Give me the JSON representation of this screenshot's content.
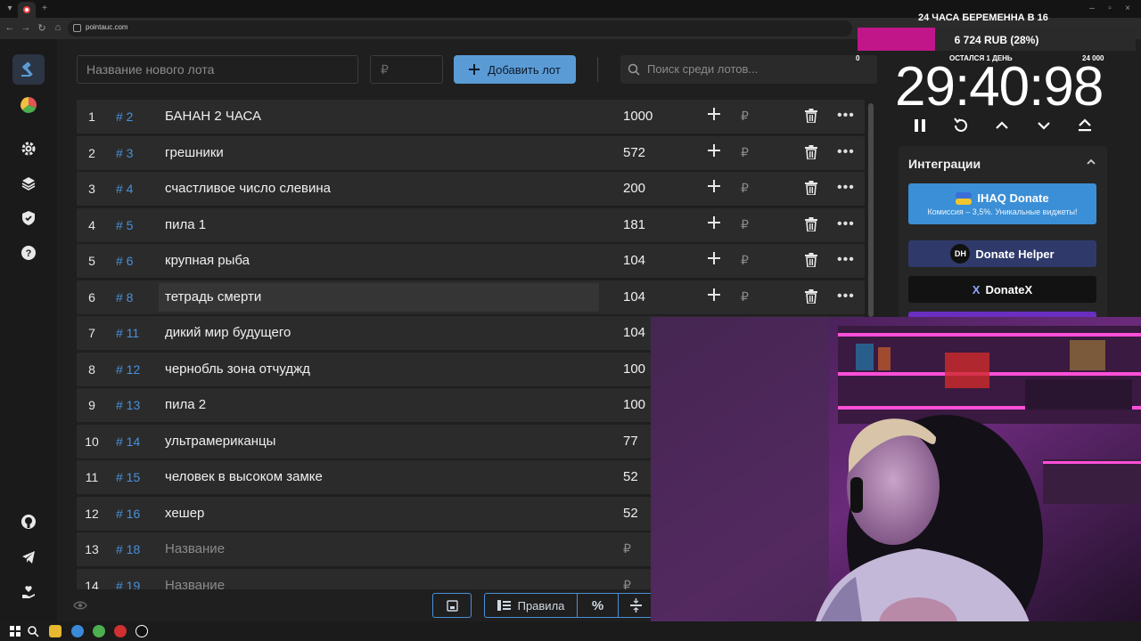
{
  "browser": {
    "url": "pointauc.com"
  },
  "toolbar": {
    "lot_name_placeholder": "Название нового лота",
    "amount_placeholder": "₽",
    "add_button_label": "Добавить лот",
    "search_placeholder": "Поиск среди лотов..."
  },
  "lots": [
    {
      "num": "1",
      "id": "# 2",
      "name": "БАНАН 2 ЧАСА",
      "amount": "1000"
    },
    {
      "num": "2",
      "id": "# 3",
      "name": "грешники",
      "amount": "572"
    },
    {
      "num": "3",
      "id": "# 4",
      "name": "счастливое число слевина",
      "amount": "200"
    },
    {
      "num": "4",
      "id": "# 5",
      "name": "пила 1",
      "amount": "181"
    },
    {
      "num": "5",
      "id": "# 6",
      "name": "крупная рыба",
      "amount": "104"
    },
    {
      "num": "6",
      "id": "# 8",
      "name": "тетрадь смерти",
      "amount": "104"
    },
    {
      "num": "7",
      "id": "# 11",
      "name": "дикий мир будущего",
      "amount": "104"
    },
    {
      "num": "8",
      "id": "# 12",
      "name": "чернобль зона отчуджд",
      "amount": "100"
    },
    {
      "num": "9",
      "id": "# 13",
      "name": "пила 2",
      "amount": "100"
    },
    {
      "num": "10",
      "id": "# 14",
      "name": "ультрамериканцы",
      "amount": "77"
    },
    {
      "num": "11",
      "id": "# 15",
      "name": "человек в высоком замке",
      "amount": "52"
    },
    {
      "num": "12",
      "id": "# 16",
      "name": "хешер",
      "amount": "52"
    },
    {
      "num": "13",
      "id": "# 18",
      "name": "Название",
      "amount": "₽"
    },
    {
      "num": "14",
      "id": "# 19",
      "name": "Название",
      "amount": "₽"
    }
  ],
  "row_rub_symbol": "₽",
  "bottom": {
    "rules_label": "Правила"
  },
  "overlay": {
    "title": "24 ЧАСА БЕРЕМЕННА В 16",
    "progress_text": "6 724 RUB (28%)",
    "progress_fraction": 0.28,
    "progress_min": "0",
    "progress_max": "24 000",
    "remaining": "ОСТАЛСЯ 1 ДЕНЬ"
  },
  "timer": {
    "value": "29:40:98"
  },
  "integrations": {
    "header": "Интеграции",
    "items": [
      {
        "title": "IHAQ Donate",
        "subtitle": "Комиссия – 3,5%. Уникальные виджеты!"
      },
      {
        "title": "Donate Helper",
        "logo": "DH"
      },
      {
        "title": "DonateX",
        "logo": "X"
      }
    ]
  },
  "colors": {
    "accent": "#5b9bd5",
    "lot_id": "#4a90d9",
    "progress": "#c0168a",
    "ihaq": "#3b8fd6",
    "donate_helper": "#2f3a6b",
    "donatex": "#121212"
  }
}
